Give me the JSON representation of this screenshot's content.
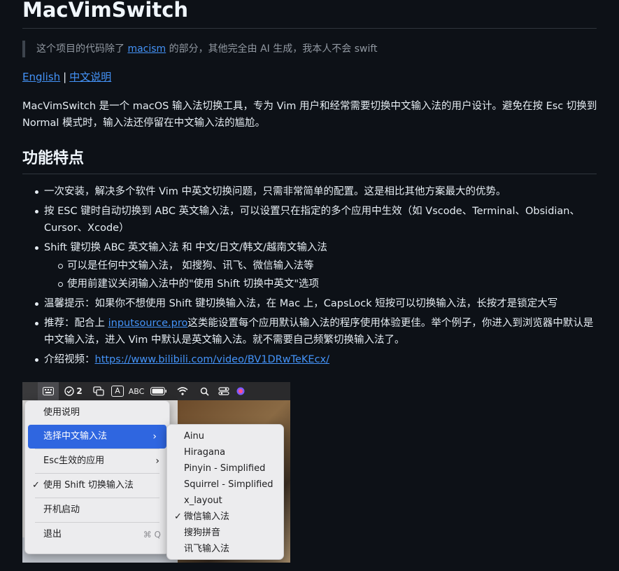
{
  "title": "MacVimSwitch",
  "quote": {
    "prefix": "这个项目的代码除了 ",
    "link": "macism",
    "suffix": " 的部分，其他完全由 AI 生成，我本人不会 swift"
  },
  "langs": {
    "english": "English",
    "sep": "|",
    "chinese": "中文说明"
  },
  "intro": "MacVimSwitch 是一个 macOS 输入法切换工具，专为 Vim 用户和经常需要切换中文输入法的用户设计。避免在按 Esc 切换到 Normal 模式时，输入法还停留在中文输入法的尴尬。",
  "features_heading": "功能特点",
  "features": {
    "f1": "一次安装，解决多个软件 Vim 中英文切换问题，只需非常简单的配置。这是相比其他方案最大的优势。",
    "f2": "按 ESC 键时自动切换到 ABC 英文输入法，可以设置只在指定的多个应用中生效（如 Vscode、Terminal、Obsidian、Cursor、Xcode）",
    "f3": "Shift 键切换 ABC 英文输入法 和 中文/日文/韩文/越南文输入法",
    "f3_sub1": "可以是任何中文输入法， 如搜狗、讯飞、微信输入法等",
    "f3_sub2": "使用前建议关闭输入法中的\"使用 Shift 切换中英文\"选项",
    "f4": "温馨提示：如果你不想使用 Shift 键切换输入法，在 Mac 上，CapsLock 短按可以切换输入法，长按才是锁定大写",
    "f5_prefix": "推荐：配合上 ",
    "f5_link": "inputsource.pro",
    "f5_suffix": "这类能设置每个应用默认输入法的程序使用体验更佳。举个例子，你进入到浏览器中默认是中文输入法，进入 Vim 中默认是英文输入法。就不需要自己频繁切换输入法了。",
    "f6_prefix": "介绍视频：",
    "f6_link": "https://www.bilibili.com/video/BV1DRwTeKEcx/"
  },
  "screenshot": {
    "menubar": {
      "badge_count": "2",
      "abc_label": "ABC"
    },
    "menu": {
      "items": [
        "使用说明",
        "选择中文输入法",
        "Esc生效的应用",
        "使用 Shift 切换输入法",
        "开机启动",
        "退出"
      ],
      "check": "✓",
      "quit_shortcut": "⌘ Q",
      "chevron": "›"
    },
    "submenu": {
      "items": [
        "Ainu",
        "Hiragana",
        "Pinyin - Simplified",
        "Squirrel - Simplified",
        "x_layout",
        "微信输入法",
        "搜狗拼音",
        "讯飞输入法"
      ],
      "check": "✓"
    }
  },
  "colors": {
    "background": "#0d1117",
    "text": "#e6edf3",
    "link": "#4493f8",
    "menu_selected": "#2f66e0"
  }
}
